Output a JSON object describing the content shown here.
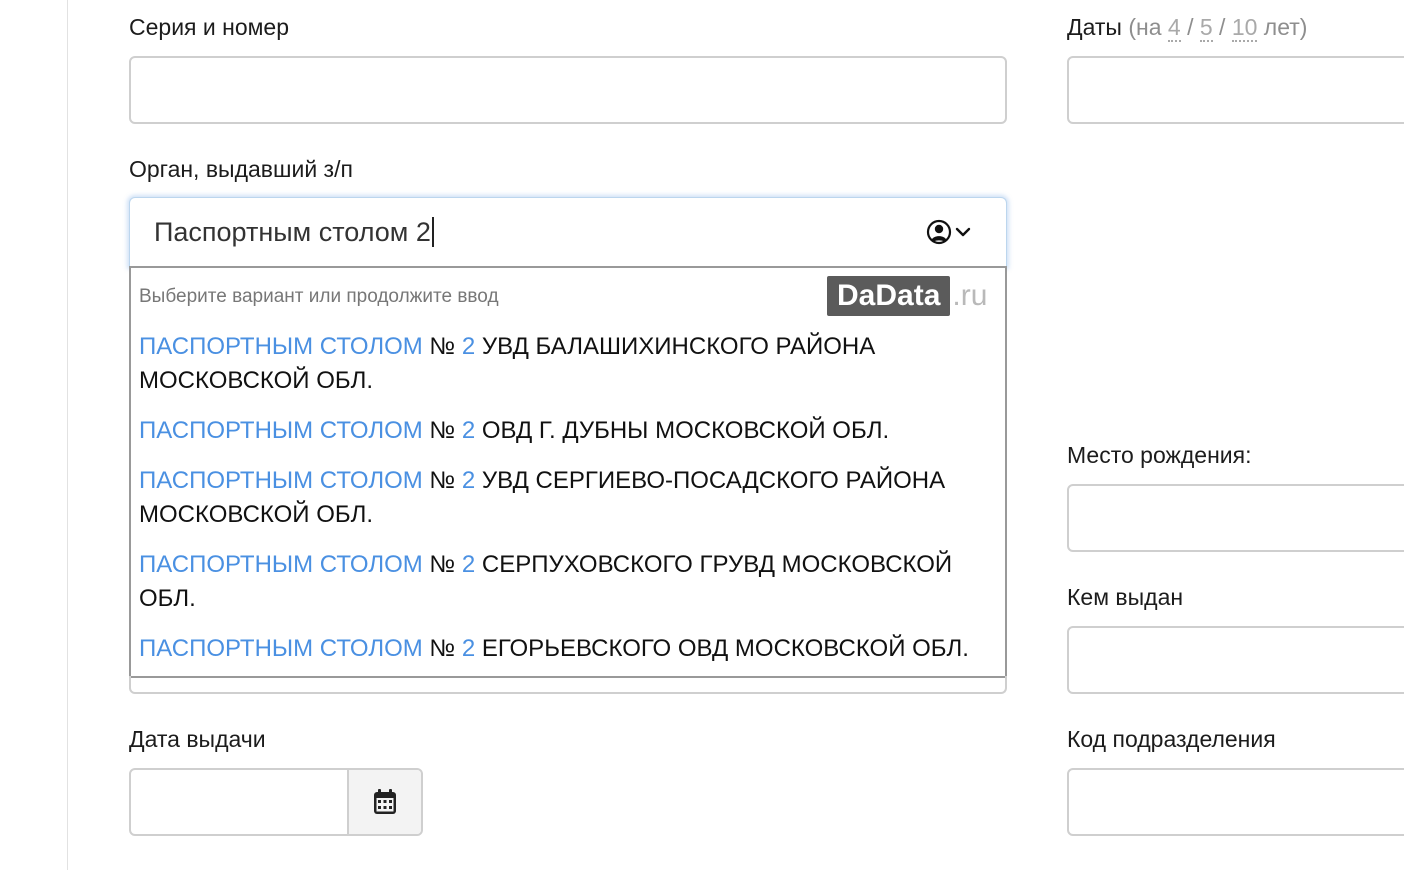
{
  "form": {
    "series_label": "Серия и номер",
    "series_value": "",
    "dates_label": {
      "main": "Даты",
      "prefix": "(на",
      "opt1": "4",
      "sep1": "/",
      "opt2": "5",
      "sep2": "/",
      "opt3": "10",
      "suffix": "лет)"
    },
    "organ_label": "Орган, выдавший з/п",
    "organ_value": "Паспортным столом 2",
    "birthplace_label": "Место рождения:",
    "issued_by_label": "Кем выдан",
    "issue_date_label": "Дата выдачи",
    "dept_code_label": "Код подразделения"
  },
  "suggestions": {
    "hint": "Выберите вариант или продолжите ввод",
    "logo_main": "DaData",
    "logo_tld": ".ru",
    "items": [
      {
        "match": "ПАСПОРТНЫМ СТОЛОМ",
        "num_sign": "№",
        "num": "2",
        "rest": "УВД БАЛАШИХИНСКОГО РАЙОНА МОСКОВСКОЙ ОБЛ."
      },
      {
        "match": "ПАСПОРТНЫМ СТОЛОМ",
        "num_sign": "№",
        "num": "2",
        "rest": "ОВД Г. ДУБНЫ МОСКОВСКОЙ ОБЛ."
      },
      {
        "match": "ПАСПОРТНЫМ СТОЛОМ",
        "num_sign": "№",
        "num": "2",
        "rest": "УВД СЕРГИЕВО-ПОСАДСКОГО РАЙОНА МОСКОВСКОЙ ОБЛ."
      },
      {
        "match": "ПАСПОРТНЫМ СТОЛОМ",
        "num_sign": "№",
        "num": "2",
        "rest": "СЕРПУХОВСКОГО ГРУВД МОСКОВСКОЙ ОБЛ."
      },
      {
        "match": "ПАСПОРТНЫМ СТОЛОМ",
        "num_sign": "№",
        "num": "2",
        "rest": "ЕГОРЬЕВСКОГО ОВД МОСКОВСКОЙ ОБЛ."
      }
    ]
  },
  "icons": {
    "organ_toggle": "user-circle-icon",
    "organ_chevron": "chevron-down-icon",
    "date_picker": "calendar-icon"
  },
  "colors": {
    "highlight": "#4a90e2",
    "logo_bg": "#5b5b5b",
    "border": "#cfcfcf"
  }
}
